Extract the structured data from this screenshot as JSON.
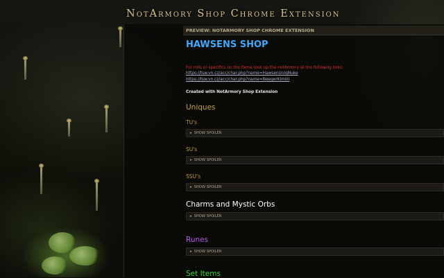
{
  "header": {
    "title": "NotArmory Shop Chrome Extension"
  },
  "preview": {
    "label": "PREVIEW: NOTARMORY SHOP CHROME EXTENSION"
  },
  "shop": {
    "title": "HAWSENS SHOP",
    "intro": "For rolls or specifics on the items look up the notArmory at the following links:",
    "links": [
      "https://tsw.vn.cz/acc/char.php?name=HawsenUniqNuke",
      "https://tsw.vn.cz/acc/char.php?name=NeegerKimiiii"
    ],
    "created": "Created with NotArmory Shop Extension"
  },
  "spoiler_label": "SHOW SPOILER",
  "spoiler_icon": "triangle-right-icon",
  "sections": {
    "uniques": {
      "title": "Uniques",
      "color": "#c9a048"
    },
    "tu": {
      "title": "TU's"
    },
    "su": {
      "title": "SU's"
    },
    "ssu": {
      "title": "SSU's"
    },
    "charms": {
      "title": "Charms and Mystic Orbs",
      "color": "#ffffff"
    },
    "runes": {
      "title": "Runes",
      "color": "#b05cf0"
    },
    "sets": {
      "title": "Set Items",
      "color": "#3fd03f"
    }
  }
}
